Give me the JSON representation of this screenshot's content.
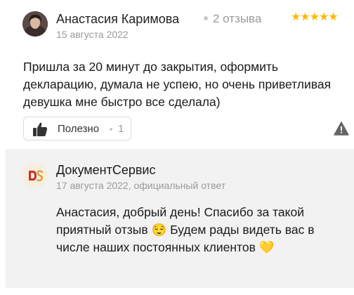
{
  "review": {
    "author_name": "Анастасия Каримова",
    "review_count": "2 отзыва",
    "stars": "★★★★★",
    "rating": 5,
    "date": "15 августа 2022",
    "text": "Пришла за 20 минут до закрытия, оформить декларацию, думала не успею, но очень приветливая девушка мне быстро все сделала)",
    "helpful_label": "Полезно",
    "helpful_count": "1",
    "star_color": "#fcb800"
  },
  "reply": {
    "company_name": "ДокументСервис",
    "meta": "17 августа 2022, официальный ответ",
    "text": "Анастасия, добрый день! Спасибо за такой приятный отзыв 😌 Будем рады видеть вас в числе наших постоянных клиентов 💛",
    "logo_text": "DS",
    "background_color": "#f2f2f2"
  }
}
